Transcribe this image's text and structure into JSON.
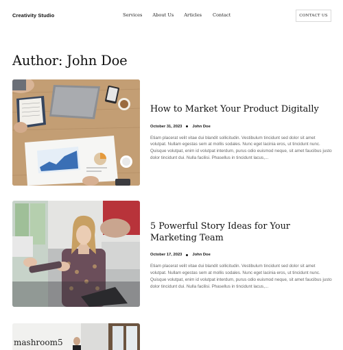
{
  "header": {
    "logo": "Creativity Studio",
    "nav": [
      "Services",
      "About Us",
      "Articles",
      "Contact"
    ],
    "cta_label": "CONTACT US"
  },
  "page_title": "Author: John Doe",
  "posts": [
    {
      "title": "How to Market Your Product Digitally",
      "date": "October 31, 2023",
      "author": "John Doe",
      "excerpt": "Etiam placerat velit vitae dui blandit sollicitudin. Vestibulum tincidunt sed dolor sit amet volutpat. Nullam egestas sem at mollis sodales. Nunc eget lacinia eros, ut tincidunt nunc. Quisque volutpat, enim id volutpat interdum, purus odio euismod neque, sit amet faucibus justo dolor tincidunt dui. Nulla facilisi. Phasellus in tincidunt lacus,..."
    },
    {
      "title": "5 Powerful Story Ideas for Your Marketing Team",
      "date": "October 17, 2023",
      "author": "John Doe",
      "excerpt": "Etiam placerat velit vitae dui blandit sollicitudin. Vestibulum tincidunt sed dolor sit amet volutpat. Nullam egestas sem at mollis sodales. Nunc eget lacinia eros, ut tincidunt nunc. Quisque volutpat, enim id volutpat interdum, purus odio euismod neque, sit amet faucibus justo dolor tincidunt dui. Nulla facilisi. Phasellus in tincidunt lacus,..."
    }
  ],
  "partial_post": {
    "image_sign_text": "mashroom5"
  }
}
